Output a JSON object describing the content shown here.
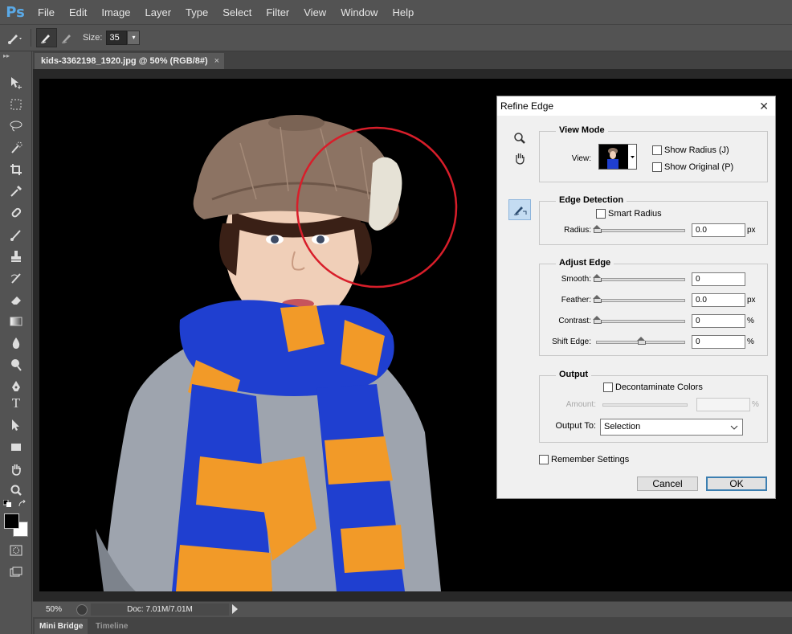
{
  "app": {
    "logo": "Ps"
  },
  "menu": [
    "File",
    "Edit",
    "Image",
    "Layer",
    "Type",
    "Select",
    "Filter",
    "View",
    "Window",
    "Help"
  ],
  "options": {
    "size_label": "Size:",
    "size_value": "35",
    "dropdown_arrow": "▾"
  },
  "toolbox": {
    "collapse": "▸▸"
  },
  "document": {
    "tab_title": "kids-3362198_1920.jpg @ 50% (RGB/8#)",
    "close": "×"
  },
  "status": {
    "zoom": "50%",
    "doc_size": "Doc: 7.01M/7.01M"
  },
  "bottom_tabs": [
    "Mini Bridge",
    "Timeline"
  ],
  "dialog": {
    "title": "Refine Edge",
    "close": "✕",
    "view_mode": {
      "title": "View Mode",
      "view_label": "View:",
      "show_radius": "Show Radius (J)",
      "show_original": "Show Original (P)"
    },
    "edge_detection": {
      "title": "Edge Detection",
      "smart_radius": "Smart Radius",
      "radius_label": "Radius:",
      "radius_value": "0.0",
      "radius_unit": "px"
    },
    "adjust_edge": {
      "title": "Adjust Edge",
      "rows": [
        {
          "label": "Smooth:",
          "value": "0",
          "unit": "",
          "level": 0
        },
        {
          "label": "Feather:",
          "value": "0.0",
          "unit": "px",
          "level": 0
        },
        {
          "label": "Contrast:",
          "value": "0",
          "unit": "%",
          "level": 0
        },
        {
          "label": "Shift Edge:",
          "value": "0",
          "unit": "%",
          "level": 0.5
        }
      ]
    },
    "output": {
      "title": "Output",
      "decontaminate": "Decontaminate Colors",
      "amount_label": "Amount:",
      "amount_unit": "%",
      "output_to_label": "Output To:",
      "output_to_value": "Selection"
    },
    "remember": "Remember Settings",
    "cancel": "Cancel",
    "ok": "OK"
  },
  "colors": {
    "brush_circle": "#d81e2a",
    "scarf_blue": "#1f3fd0",
    "scarf_orange": "#f29a28",
    "sweater_gray": "#9ea4ae",
    "cap_brown": "#8c7363"
  },
  "icons": {
    "tools": [
      "move-icon",
      "marquee-icon",
      "lasso-icon",
      "quick-selection-icon",
      "crop-icon",
      "eyedropper-icon",
      "healing-brush-icon",
      "brush-icon",
      "clone-stamp-icon",
      "history-brush-icon",
      "eraser-icon",
      "gradient-icon",
      "blur-icon",
      "dodge-icon",
      "pen-icon",
      "type-icon",
      "path-selection-icon",
      "rectangle-icon",
      "hand-icon",
      "zoom-icon"
    ],
    "dialog_tools": [
      "zoom-icon",
      "hand-icon",
      "refine-radius-brush-icon"
    ]
  }
}
